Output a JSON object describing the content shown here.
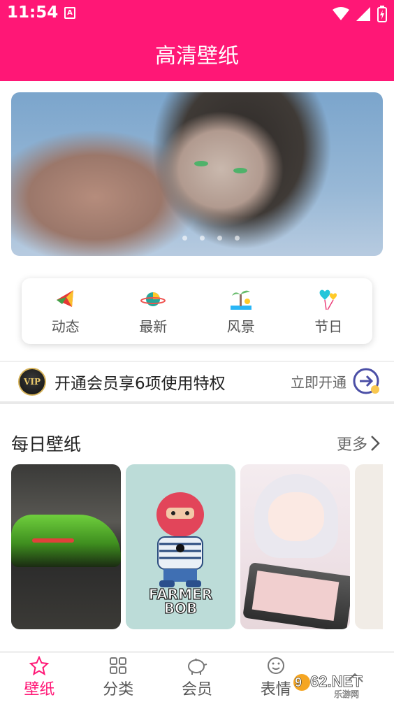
{
  "status": {
    "time": "11:54",
    "notif_glyph": "A"
  },
  "app": {
    "title": "高清壁纸"
  },
  "quick": [
    {
      "label": "动态",
      "icon": "kite-icon"
    },
    {
      "label": "最新",
      "icon": "planet-icon"
    },
    {
      "label": "风景",
      "icon": "palm-tree-icon"
    },
    {
      "label": "节日",
      "icon": "balloon-hearts-icon"
    }
  ],
  "vip": {
    "badge": "VIP",
    "text": "开通会员享6项使用特权",
    "action": "立即开通"
  },
  "daily": {
    "title": "每日壁纸",
    "more": "更多"
  },
  "thumb2": {
    "line1": "FARMER",
    "line2": "BOB"
  },
  "nav": [
    {
      "label": "壁纸",
      "active": true
    },
    {
      "label": "分类"
    },
    {
      "label": "会员"
    },
    {
      "label": "表情"
    }
  ],
  "watermark": {
    "brand": "962.NET",
    "sub": "乐游网"
  },
  "colors": {
    "brand": "#ff1776"
  }
}
